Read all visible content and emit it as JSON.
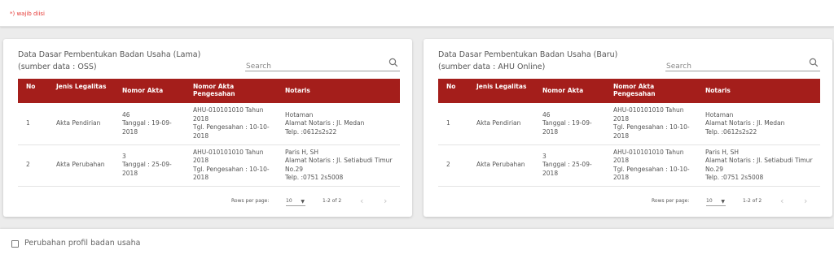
{
  "form": {
    "required_note": "*) wajib diisi"
  },
  "cards": {
    "old": {
      "title": "Data Dasar Pembentukan Badan Usaha (Lama)",
      "subtitle": "(sumber data : OSS)",
      "search_placeholder": "Search",
      "columns": {
        "no": "No",
        "jenis": "Jenis Legalitas",
        "nomor_akta": "Nomor Akta",
        "nomor_akta_pengesahan": "Nomor Akta Pengesahan",
        "notaris": "Notaris"
      },
      "rows": [
        {
          "no": "1",
          "jenis": "Akta Pendirian",
          "nomor_akta": "46",
          "tanggal": "Tanggal : 19-09-2018",
          "nomor_pengesahan": "AHU-010101010 Tahun 2018",
          "tgl_pengesahan": "Tgl. Pengesahan : 10-10-2018",
          "notaris_nama": "Hotaman",
          "notaris_alamat": "Alamat Notaris : Jl. Medan",
          "notaris_telp": "Telp. :0612s2s22"
        },
        {
          "no": "2",
          "jenis": "Akta Perubahan",
          "nomor_akta": "3",
          "tanggal": "Tanggal : 25-09-2018",
          "nomor_pengesahan": "AHU-010101010 Tahun 2018",
          "tgl_pengesahan": "Tgl. Pengesahan : 10-10-2018",
          "notaris_nama": "Paris H, SH",
          "notaris_alamat": "Alamat Notaris : Jl. Setiabudi Timur No.29",
          "notaris_telp": "Telp. :0751 2s5008"
        }
      ],
      "pagination": {
        "rows_per_page_label": "Rows per page:",
        "rows_per_page_value": "10",
        "range": "1-2 of 2"
      }
    },
    "new": {
      "title": "Data Dasar Pembentukan Badan Usaha (Baru)",
      "subtitle": "(sumber data : AHU Online)",
      "search_placeholder": "Search",
      "columns": {
        "no": "No",
        "jenis": "Jenis Legalitas",
        "nomor_akta": "Nomor Akta",
        "nomor_akta_pengesahan": "Nomor Akta Pengesahan",
        "notaris": "Notaris"
      },
      "rows": [
        {
          "no": "1",
          "jenis": "Akta Pendirian",
          "nomor_akta": "46",
          "tanggal": "Tanggal : 19-09-2018",
          "nomor_pengesahan": "AHU-010101010 Tahun 2018",
          "tgl_pengesahan": "Tgl. Pengesahan : 10-10-2018",
          "notaris_nama": "Hotaman",
          "notaris_alamat": "Alamat Notaris : Jl. Medan",
          "notaris_telp": "Telp. :0612s2s22"
        },
        {
          "no": "2",
          "jenis": "Akta Perubahan",
          "nomor_akta": "3",
          "tanggal": "Tanggal : 25-09-2018",
          "nomor_pengesahan": "AHU-010101010 Tahun 2018",
          "tgl_pengesahan": "Tgl. Pengesahan : 10-10-2018",
          "notaris_nama": "Paris H, SH",
          "notaris_alamat": "Alamat Notaris : Jl. Setiabudi Timur No.29",
          "notaris_telp": "Telp. :0751 2s5008"
        }
      ],
      "pagination": {
        "rows_per_page_label": "Rows per page:",
        "rows_per_page_value": "10",
        "range": "1-2 of 2"
      }
    }
  },
  "profile_change": {
    "label": "Perubahan profil badan usaha",
    "checked": false
  },
  "icons": {
    "search": "search-icon",
    "prev": "chevron-left-icon",
    "next": "chevron-right-icon",
    "dropdown": "caret-down-icon"
  },
  "colors": {
    "table_header": "#a41e1b",
    "required_text": "#e53935"
  }
}
